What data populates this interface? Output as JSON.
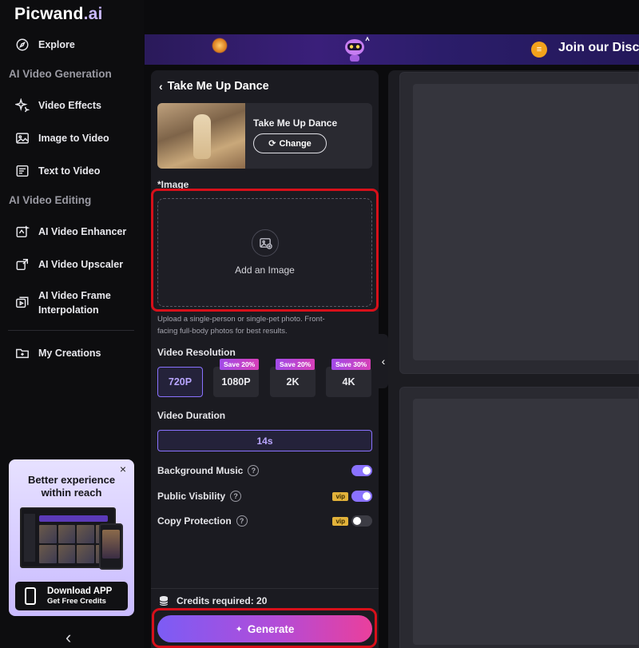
{
  "brand": {
    "name_main": "Picwand",
    "name_accent": ".ai"
  },
  "sidebar": {
    "explore": "Explore",
    "section_generation": "AI Video Generation",
    "video_effects": "Video Effects",
    "image_to_video": "Image to Video",
    "text_to_video": "Text to Video",
    "section_editing": "AI Video Editing",
    "enhancer": "AI Video Enhancer",
    "upscaler": "AI Video Upscaler",
    "frame_interp_1": "AI Video Frame",
    "frame_interp_2": "Interpolation",
    "my_creations": "My Creations"
  },
  "promo": {
    "close": "×",
    "title_1": "Better experience",
    "title_2": "within reach",
    "btn_title": "Download APP",
    "btn_sub": "Get Free Credits"
  },
  "banner": {
    "text": "Join our Disc"
  },
  "panel": {
    "title": "Take Me Up Dance",
    "effect_name": "Take Me Up Dance",
    "change_label": "Change",
    "image_label": "*Image",
    "upload_text": "Add an Image",
    "hint_1": "Upload a single-person or single-pet photo. Front-",
    "hint_2": "facing full-body photos for best results.",
    "resolution_label": "Video Resolution",
    "resolutions": [
      {
        "label": "720P",
        "badge": ""
      },
      {
        "label": "1080P",
        "badge": "Save 20%"
      },
      {
        "label": "2K",
        "badge": "Save 20%"
      },
      {
        "label": "4K",
        "badge": "Save 30%"
      }
    ],
    "duration_label": "Video Duration",
    "duration_value": "14s",
    "bg_music": "Background Music",
    "public_visibility": "Public Visbility",
    "copy_protection": "Copy Protection",
    "vip": "vip",
    "credits_label": "Credits required:",
    "credits_value": "20",
    "generate": "Generate"
  },
  "toggles": {
    "bg_music": true,
    "public_visibility": true,
    "copy_protection": false
  },
  "colors": {
    "accent": "#8a72ff",
    "highlight": "#d7101a",
    "panel": "#1b1b21"
  }
}
